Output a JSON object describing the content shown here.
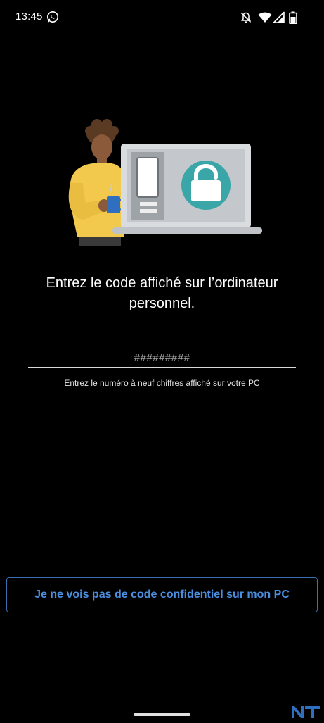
{
  "status_bar": {
    "time": "13:45",
    "icons": [
      "whatsapp-icon",
      "silent-alarm-icon",
      "wifi-icon",
      "signal-icon",
      "battery-icon"
    ]
  },
  "illustration": {
    "description_icon": "person-laptop-lock-illustration"
  },
  "main": {
    "title": "Entrez le code affiché sur l’ordinateur personnel.",
    "code_input": {
      "placeholder": "#########",
      "value": ""
    },
    "helper_text": "Entrez le numéro à neuf chiffres affiché sur votre PC"
  },
  "footer": {
    "no_code_button_label": "Je ne vois pas de code confidentiel sur mon PC"
  },
  "colors": {
    "background": "#000000",
    "text": "#ffffff",
    "accent_link": "#4a90e2",
    "button_border": "#3a6fb0",
    "lock_teal": "#3aa6a8",
    "sweater_yellow": "#f2c94c"
  }
}
